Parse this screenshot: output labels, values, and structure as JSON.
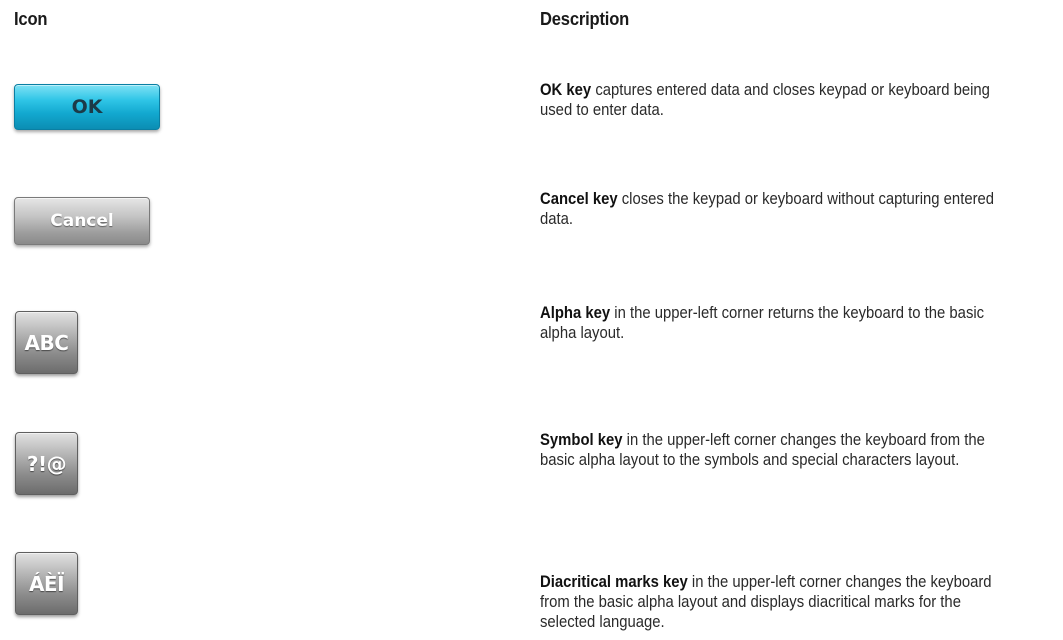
{
  "headers": {
    "icon": "Icon",
    "description": "Description"
  },
  "rows": [
    {
      "key_label": "OK",
      "key_style": "blue",
      "name": "OK key",
      "text": " captures entered data and closes keypad or keyboard being used to enter data."
    },
    {
      "key_label": "Cancel",
      "key_style": "grey",
      "name": "Cancel key",
      "text": " closes the keypad or keyboard without capturing entered data."
    },
    {
      "key_label": "ABC",
      "key_style": "grey-square",
      "name": "Alpha key",
      "text": " in the upper-left corner returns the keyboard to the basic alpha layout."
    },
    {
      "key_label": "?!@",
      "key_style": "grey-square",
      "name": "Symbol key",
      "text": " in the upper-left corner changes the keyboard from the basic alpha layout to the symbols and special characters layout."
    },
    {
      "key_label": "ÁÈÏ",
      "key_style": "grey-square",
      "name": "Diacritical marks key",
      "text": " in the upper-left corner changes the keyboard from the basic alpha layout and displays diacritical marks for the selected language."
    }
  ],
  "colors": {
    "ok_key": "#12a8cf",
    "grey_key": "#9e9e9e"
  }
}
